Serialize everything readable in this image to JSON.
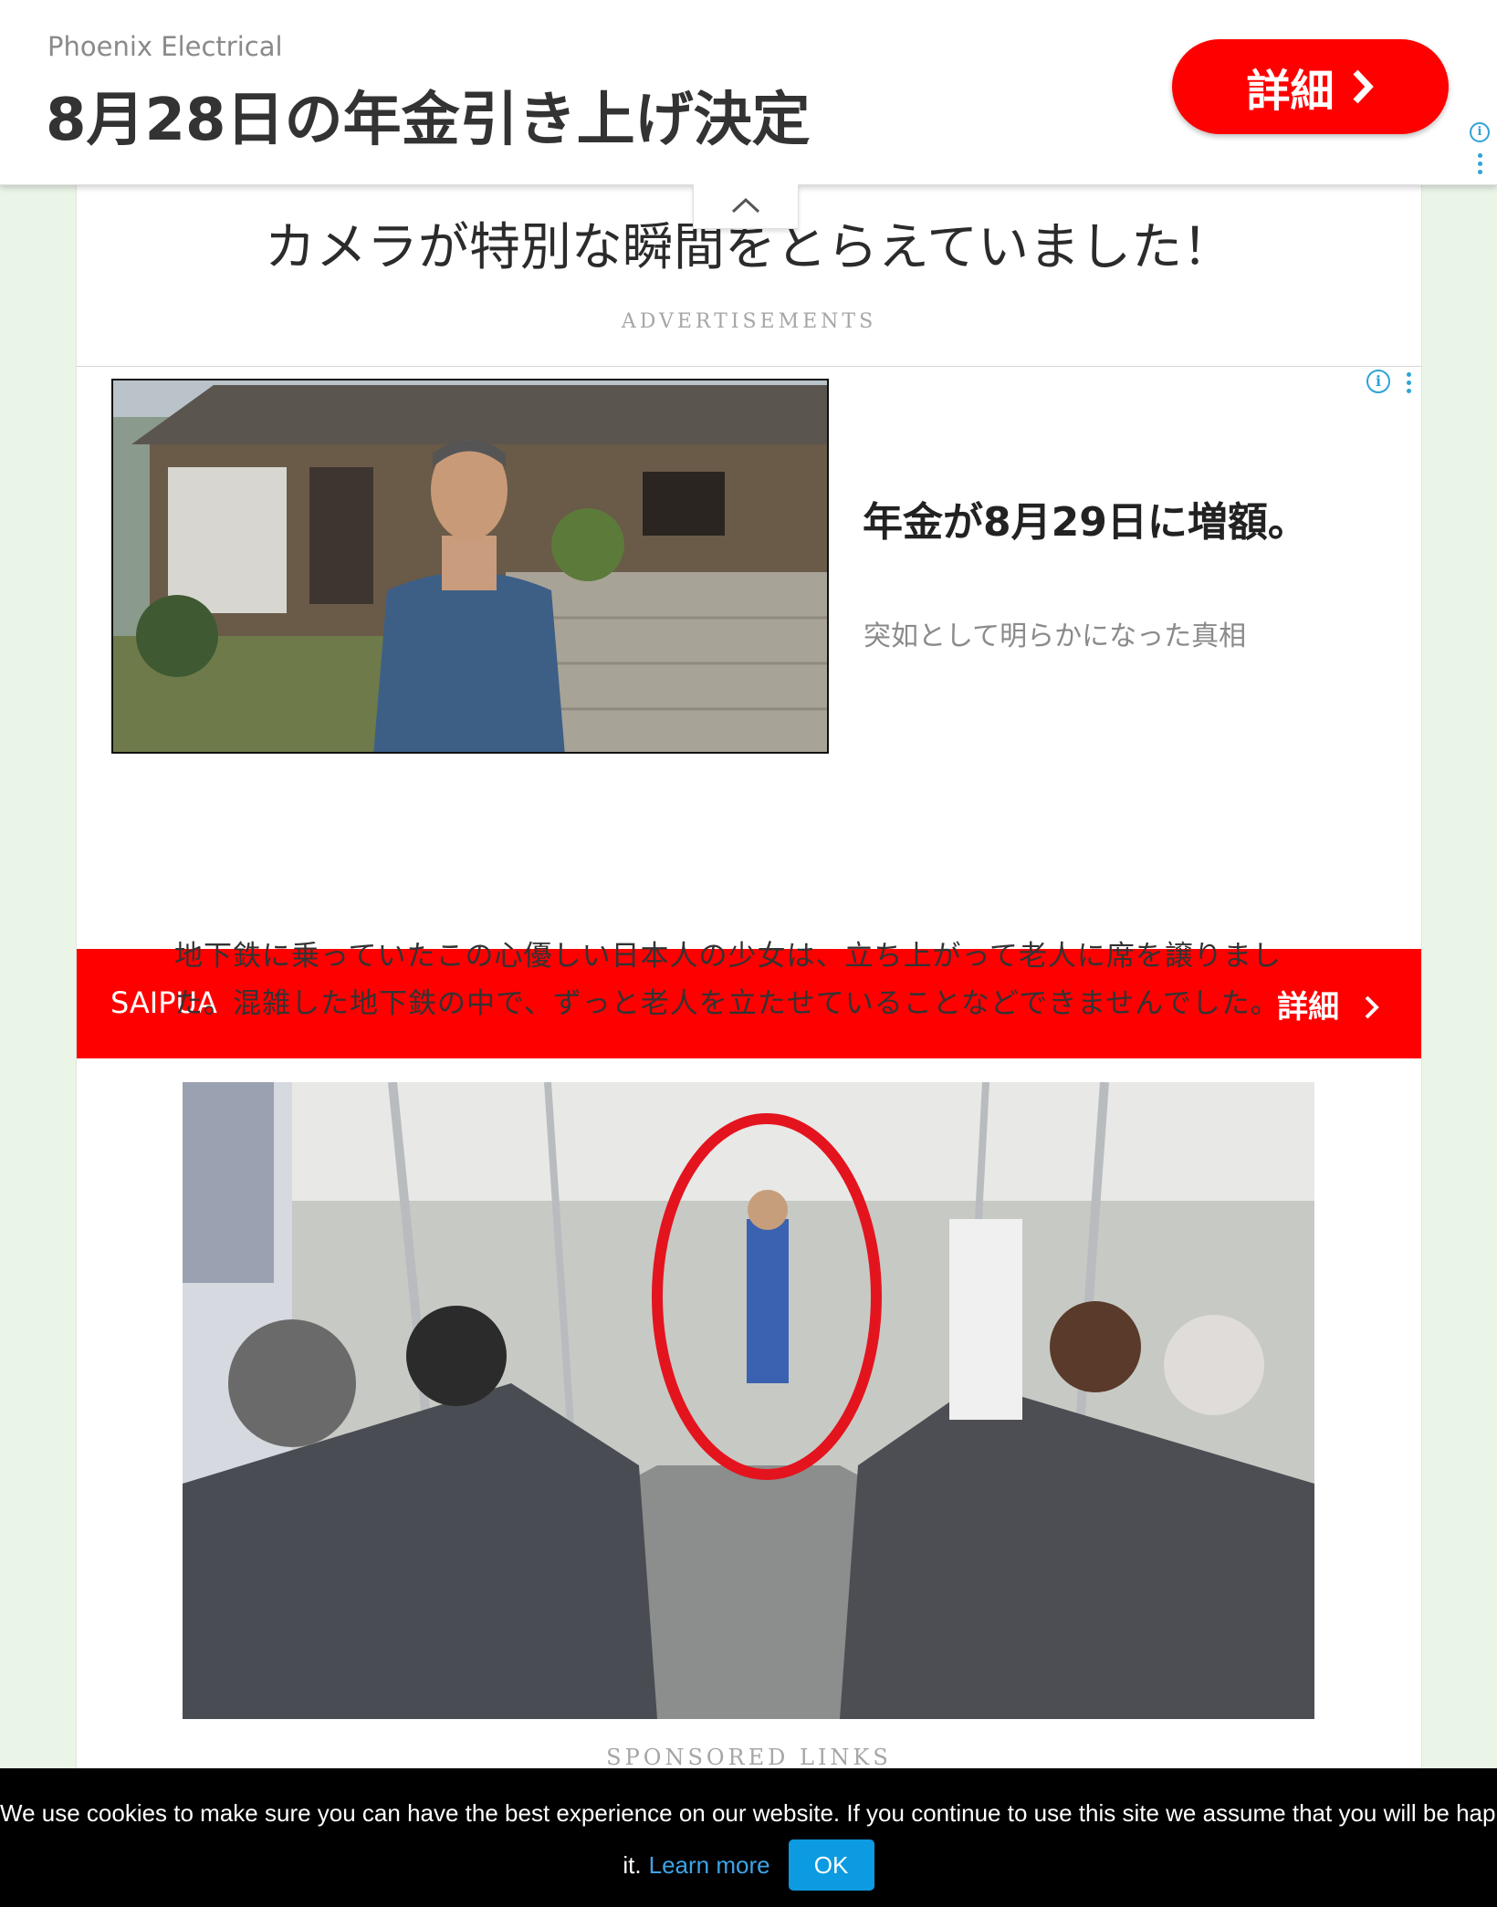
{
  "top_ad": {
    "advertiser": "Phoenix Electrical",
    "title": "8月28日の年金引き上げ決定",
    "button_label": "詳細",
    "info_icon": "info-icon",
    "menu_icon": "kebab-menu-icon"
  },
  "article": {
    "headline": "カメラが特別な瞬間をとらえていました！",
    "ads_label": "ADVERTISEMENTS",
    "paragraph": "地下鉄に乗っていたこの心優しい日本人の少女は、立ち上がって老人に席を譲りました。混雑した地下鉄の中で、ずっと老人を立たせていることなどできませんでした。",
    "sponsored_label": "SPONSORED LINKS"
  },
  "native_ad": {
    "title": "年金が8月29日に増額。",
    "subtitle": "突如として明らかになった真相",
    "advertiser": "SAIPUA",
    "details_label": "詳細"
  },
  "cookie_bar": {
    "text_line1": "We use cookies to make sure you can have the best experience on our website. If you continue to use this site we assume that you will be happy with",
    "text_line2": "it.",
    "learn_more": "Learn more",
    "ok_label": "OK"
  },
  "colors": {
    "accent_red": "#ff0000",
    "info_blue": "#2fa3d5",
    "ok_blue": "#0c9be0",
    "page_background": "#eaf4e7"
  }
}
